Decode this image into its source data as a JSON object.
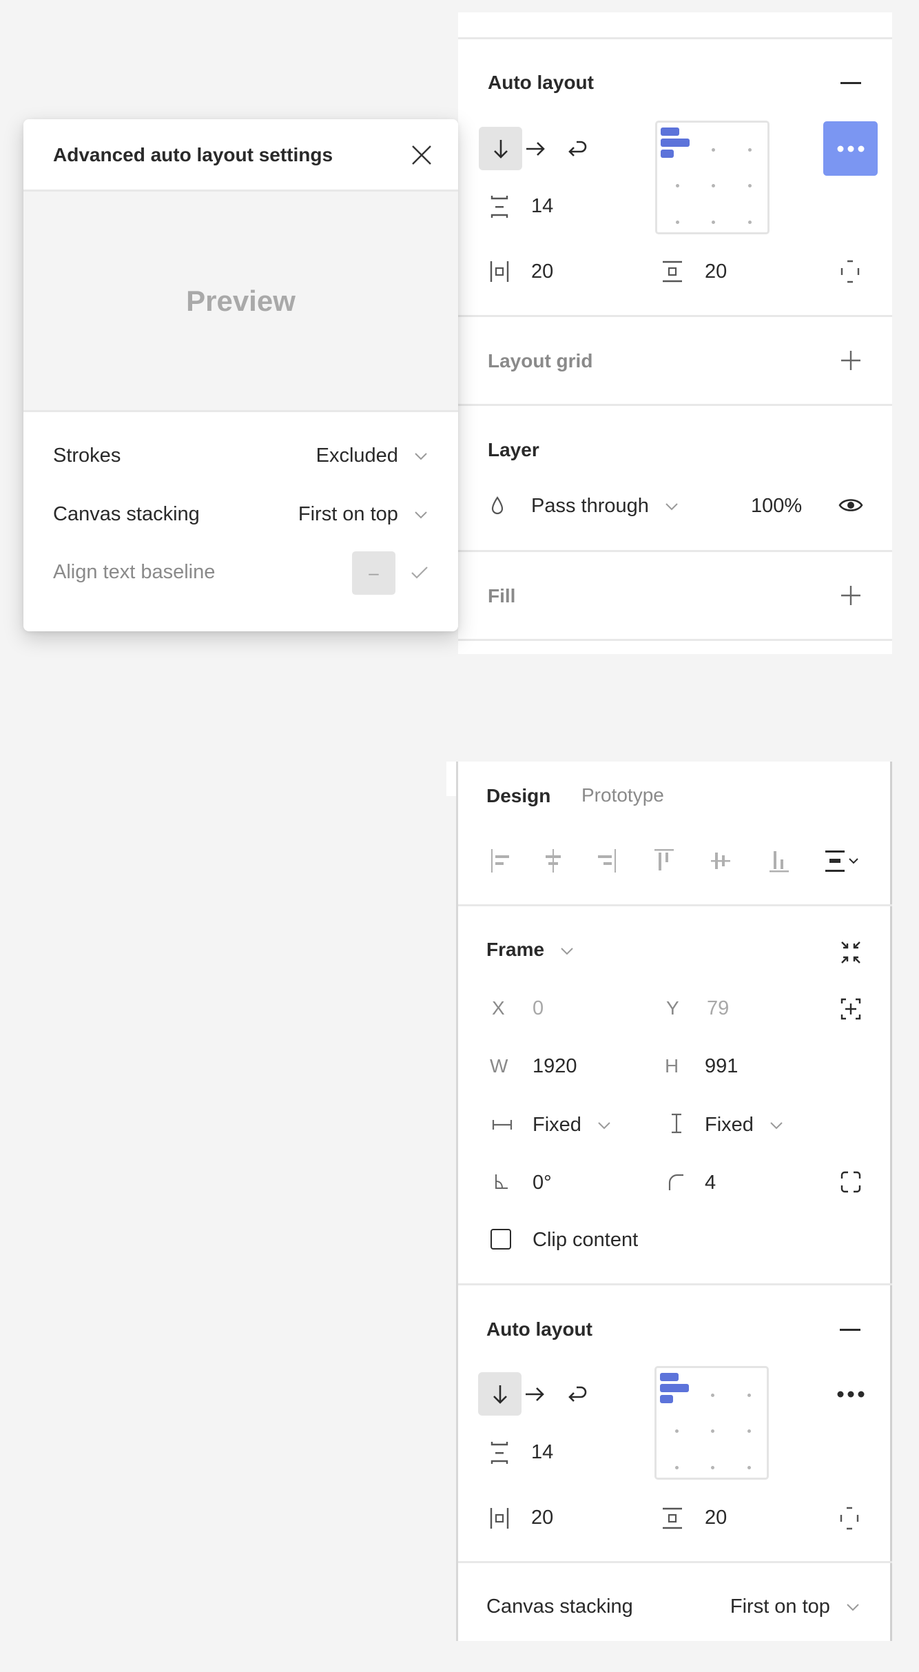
{
  "colors": {
    "accent_button": "#7b96f2",
    "alignment_bar": "#5c73da",
    "background": "#f4f4f4",
    "panel": "#ffffff",
    "text_primary": "#2a2a2a",
    "text_muted": "#8a8a8a"
  },
  "top_panel": {
    "auto_layout": {
      "title": "Auto layout",
      "remove_icon": "minus-icon",
      "direction_buttons": [
        {
          "icon": "arrow-down-icon",
          "label": "Vertical",
          "active": true
        },
        {
          "icon": "arrow-right-icon",
          "label": "Horizontal",
          "active": false
        },
        {
          "icon": "wrap-icon",
          "label": "Wrap",
          "active": false
        }
      ],
      "spacing_value": "14",
      "horizontal_padding": "20",
      "vertical_padding": "20",
      "alignment": "top-left",
      "more_button_icon": "more-horizontal-icon",
      "more_button_active": true
    },
    "layout_grid": {
      "title": "Layout grid",
      "add_icon": "plus-icon"
    },
    "layer": {
      "title": "Layer",
      "blend_mode": "Pass through",
      "opacity": "100%",
      "visibility_icon": "eye-icon"
    },
    "fill": {
      "title": "Fill",
      "add_icon": "plus-icon"
    }
  },
  "dialog": {
    "title": "Advanced auto layout settings",
    "close_icon": "close-icon",
    "preview_label": "Preview",
    "rows": [
      {
        "label": "Strokes",
        "value": "Excluded"
      },
      {
        "label": "Canvas stacking",
        "value": "First on top"
      },
      {
        "label": "Align text baseline",
        "value": "–",
        "disabled": true
      }
    ]
  },
  "bottom_panel": {
    "tabs": [
      {
        "label": "Design",
        "active": true
      },
      {
        "label": "Prototype",
        "active": false
      }
    ],
    "align_tools": [
      "align-left-icon",
      "align-horizontal-center-icon",
      "align-right-icon",
      "align-top-icon",
      "align-vertical-center-icon",
      "align-bottom-icon",
      "distribute-icon"
    ],
    "frame": {
      "title": "Frame",
      "x_label": "X",
      "x_value": "0",
      "y_label": "Y",
      "y_value": "79",
      "w_label": "W",
      "w_value": "1920",
      "h_label": "H",
      "h_value": "991",
      "width_mode": "Fixed",
      "height_mode": "Fixed",
      "rotation": "0°",
      "corner_radius": "4",
      "clip_content_label": "Clip content",
      "clip_content_checked": false
    },
    "auto_layout": {
      "title": "Auto layout",
      "spacing_value": "14",
      "horizontal_padding": "20",
      "vertical_padding": "20"
    },
    "canvas_stacking": {
      "label": "Canvas stacking",
      "value": "First on top"
    }
  }
}
